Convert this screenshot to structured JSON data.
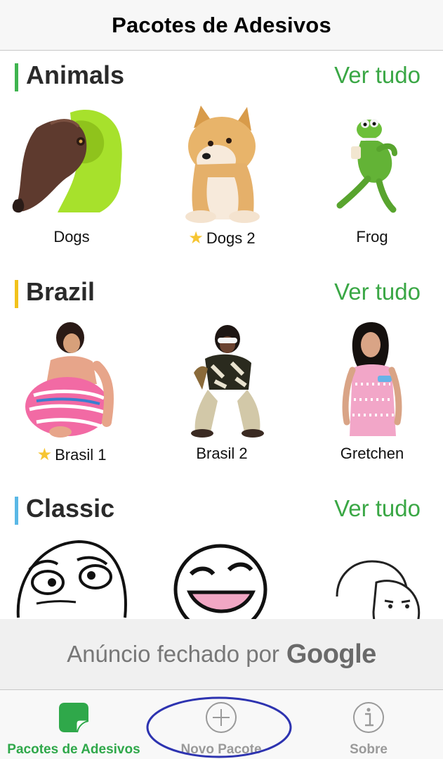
{
  "navbar": {
    "title": "Pacotes de Adesivos"
  },
  "sections": [
    {
      "title": "Animals",
      "see_all": "Ver tudo",
      "accent_color": "#3fb44f",
      "stickers": [
        {
          "label": "Dogs",
          "starred": false
        },
        {
          "label": "Dogs 2",
          "starred": true
        },
        {
          "label": "Frog",
          "starred": false
        }
      ]
    },
    {
      "title": "Brazil",
      "see_all": "Ver tudo",
      "accent_color": "#f2c21b",
      "stickers": [
        {
          "label": "Brasil 1",
          "starred": true
        },
        {
          "label": "Brasil 2",
          "starred": false
        },
        {
          "label": "Gretchen",
          "starred": false
        }
      ]
    },
    {
      "title": "Classic",
      "see_all": "Ver tudo",
      "accent_color": "#5ab8e6",
      "stickers": [
        {
          "label": "",
          "starred": false
        },
        {
          "label": "",
          "starred": false
        },
        {
          "label": "",
          "starred": false
        }
      ]
    }
  ],
  "ad": {
    "text": "Anúncio fechado por",
    "brand": "Google"
  },
  "tabbar": {
    "tabs": [
      {
        "label": "Pacotes de Adesivos",
        "icon": "sticker-pack-icon",
        "active": true
      },
      {
        "label": "Novo Pacote",
        "icon": "plus-circle-icon",
        "active": false
      },
      {
        "label": "Sobre",
        "icon": "info-circle-icon",
        "active": false
      }
    ]
  },
  "colors": {
    "accent_green": "#3aa745",
    "tab_active": "#2fa84a",
    "annotation_circle": "#2d33b0"
  }
}
